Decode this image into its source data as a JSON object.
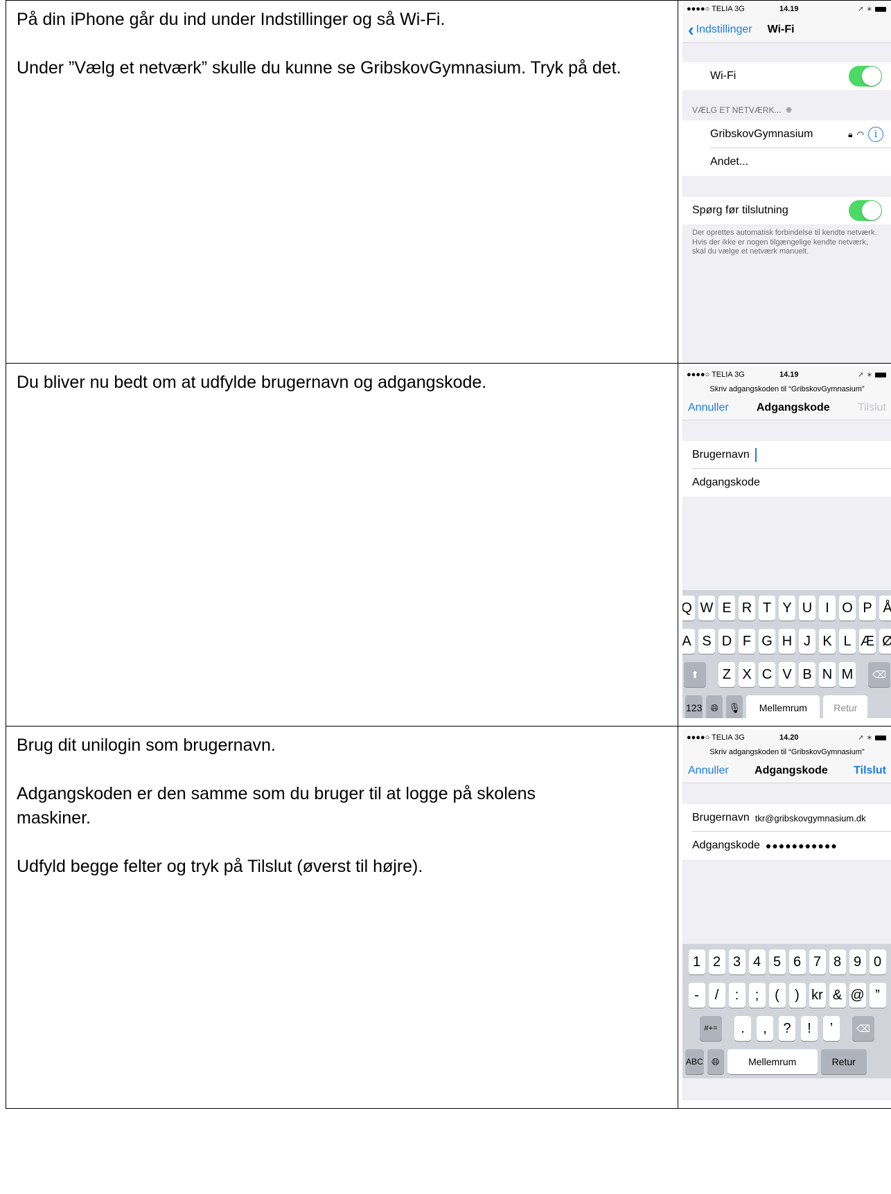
{
  "rows": [
    {
      "paragraphs": [
        "På din iPhone går du ind under Indstillinger og så Wi-Fi.",
        "Under ”Vælg et netværk” skulle du kunne se GribskovGymnasium. Tryk på det."
      ],
      "phone": {
        "carrier": "●●●●○ TELIA  3G",
        "time": "14.19",
        "back_label": "Indstillinger",
        "title": "Wi-Fi",
        "wifi_label": "Wi-Fi",
        "section_header": "VÆLG ET NETVÆRK...",
        "network_name": "GribskovGymnasium",
        "other_label": "Andet...",
        "ask_label": "Spørg før tilslutning",
        "footnote": "Der oprettes automatisk forbindelse til kendte netværk. Hvis der ikke er nogen tilgængelige kendte netværk, skal du vælge et netværk manuelt."
      }
    },
    {
      "paragraphs": [
        "Du bliver nu bedt om at udfylde brugernavn og adgangskode."
      ],
      "phone": {
        "carrier": "●●●●○ TELIA  3G",
        "time": "14.19",
        "prompt": "Skriv adgangskoden til “GribskovGymnasium”",
        "cancel": "Annuller",
        "title": "Adgangskode",
        "connect": "Tilslut",
        "username_label": "Brugernavn",
        "password_label": "Adgangskode",
        "keyboard": {
          "row1": [
            "Q",
            "W",
            "E",
            "R",
            "T",
            "Y",
            "U",
            "I",
            "O",
            "P",
            "Å"
          ],
          "row2": [
            "A",
            "S",
            "D",
            "F",
            "G",
            "H",
            "J",
            "K",
            "L",
            "Æ",
            "Ø"
          ],
          "row3": [
            "Z",
            "X",
            "C",
            "V",
            "B",
            "N",
            "M"
          ],
          "numbers_key": "123",
          "space": "Mellemrum",
          "return": "Retur"
        }
      }
    },
    {
      "paragraphs": [
        "Brug dit unilogin som brugernavn.",
        "Adgangskoden er den samme som du bruger til at logge på skolens maskiner.",
        "Udfyld begge felter og tryk på Tilslut (øverst til højre)."
      ],
      "phone": {
        "carrier": "●●●●○ TELIA  3G",
        "time": "14.20",
        "prompt": "Skriv adgangskoden til “GribskovGymnasium”",
        "cancel": "Annuller",
        "title": "Adgangskode",
        "connect": "Tilslut",
        "username_label": "Brugernavn",
        "username_value": "tkr@gribskovgymnasium.dk",
        "password_label": "Adgangskode",
        "password_value": "●●●●●●●●●●●",
        "keyboard": {
          "row1": [
            "1",
            "2",
            "3",
            "4",
            "5",
            "6",
            "7",
            "8",
            "9",
            "0"
          ],
          "row2": [
            "-",
            "/",
            ":",
            ";",
            "(",
            ")",
            "kr",
            "&",
            "@",
            "”"
          ],
          "row3": [
            ".",
            ",",
            "?",
            "!",
            "’"
          ],
          "symbols_key": "#+=",
          "abc_key": "ABC",
          "space": "Mellemrum",
          "return": "Retur"
        }
      }
    }
  ]
}
